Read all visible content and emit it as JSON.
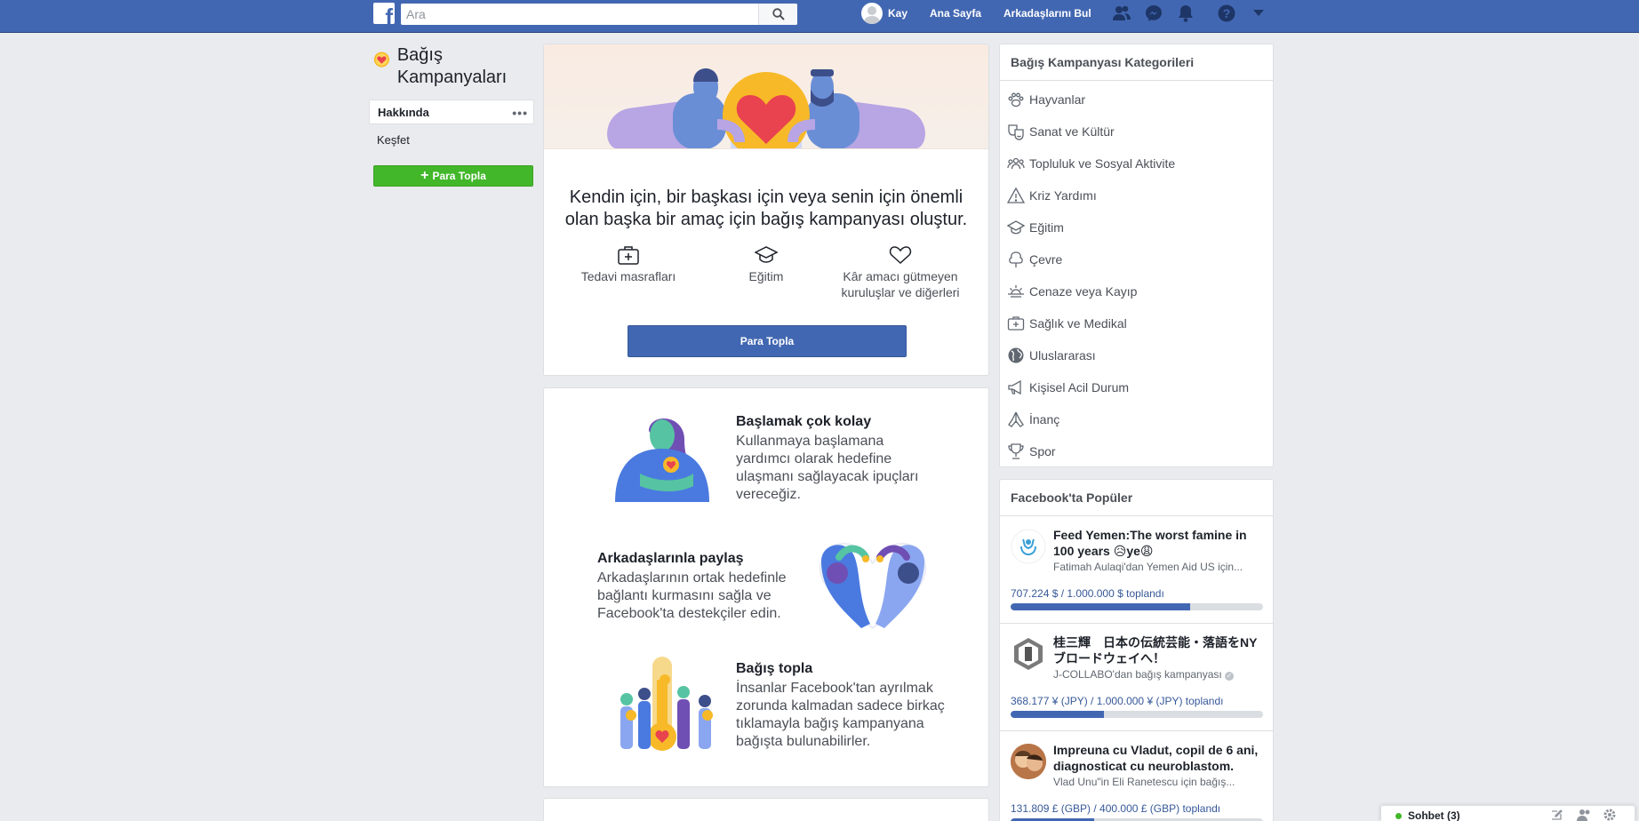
{
  "topbar": {
    "search_placeholder": "Ara",
    "user_name": "Kay",
    "home": "Ana Sayfa",
    "find_friends": "Arkadaşlarını Bul"
  },
  "left": {
    "title": "Bağış Kampanyaları",
    "nav": [
      {
        "label": "Hakkında",
        "active": true
      },
      {
        "label": "Keşfet",
        "active": false
      }
    ],
    "button": "Para Topla"
  },
  "hero": {
    "text": "Kendin için, bir başkası için veya senin için önemli olan başka bir amaç için bağış kampanyası oluştur.",
    "categories": [
      {
        "label": "Tedavi masrafları",
        "icon": "medical-kit-icon"
      },
      {
        "label": "Eğitim",
        "icon": "graduation-cap-icon"
      },
      {
        "label": "Kâr amacı gütmeyen kuruluşlar ve diğerleri",
        "icon": "heart-outline-icon"
      }
    ],
    "button": "Para Topla"
  },
  "steps": [
    {
      "title": "Başlamak çok kolay",
      "text": "Kullanmaya başlamana yardımcı olarak hedefine ulaşmanı sağlayacak ipuçları vereceğiz."
    },
    {
      "title": "Arkadaşlarınla paylaş",
      "text": "Arkadaşlarının ortak hedefinle bağlantı kurmasını sağla ve Facebook'ta destekçiler edin."
    },
    {
      "title": "Bağış topla",
      "text": "İnsanlar Facebook'tan ayrılmak zorunda kalmadan sadece birkaç tıklamayla bağış kampanyana bağışta bulunabilirler."
    }
  ],
  "categories_panel": {
    "title": "Bağış Kampanyası Kategorileri",
    "items": [
      {
        "label": "Hayvanlar",
        "icon": "paw-icon"
      },
      {
        "label": "Sanat ve Kültür",
        "icon": "theater-masks-icon"
      },
      {
        "label": "Topluluk ve Sosyal Aktivite",
        "icon": "people-group-icon"
      },
      {
        "label": "Kriz Yardımı",
        "icon": "warning-icon"
      },
      {
        "label": "Eğitim",
        "icon": "graduation-cap-icon"
      },
      {
        "label": "Çevre",
        "icon": "tree-icon"
      },
      {
        "label": "Cenaze veya Kayıp",
        "icon": "sunset-icon"
      },
      {
        "label": "Sağlık ve Medikal",
        "icon": "medical-kit-icon"
      },
      {
        "label": "Uluslararası",
        "icon": "globe-icon"
      },
      {
        "label": "Kişisel Acil Durum",
        "icon": "megaphone-icon"
      },
      {
        "label": "İnanç",
        "icon": "praying-hands-icon"
      },
      {
        "label": "Spor",
        "icon": "trophy-icon"
      }
    ]
  },
  "popular": {
    "title": "Facebook'ta Popüler",
    "items": [
      {
        "title": "Feed Yemen:The worst famine in 100 years 😥ye😩",
        "subtitle": "Fatimah Aulaqi'dan Yemen Aid US için...",
        "raised": "707.224 $ / 1.000.000 $ toplandı",
        "progress": 0.71
      },
      {
        "title": "桂三輝　日本の伝統芸能・落語をNYブロードウェイへ！",
        "subtitle": "J-COLLABO'dan bağış kampanyası",
        "raised": "368.177 ¥ (JPY) / 1.000.000 ¥ (JPY) toplandı",
        "progress": 0.37
      },
      {
        "title": "Impreuna cu Vladut, copil de 6 ani, diagnosticat cu neuroblastom.",
        "subtitle": "Vlad Unu\"in Eli Ranetescu için bağış...",
        "raised": "131.809 £ (GBP) / 400.000 £ (GBP) toplandı",
        "progress": 0.33
      }
    ]
  },
  "chat": {
    "label": "Sohbet (3)"
  }
}
